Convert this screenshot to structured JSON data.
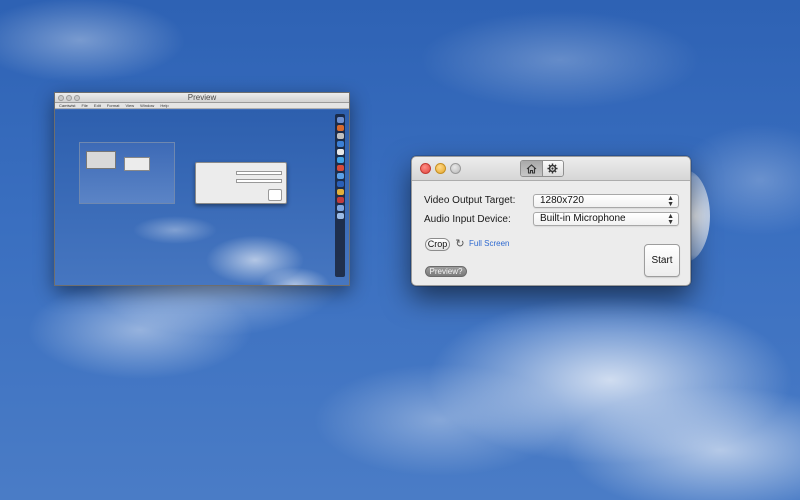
{
  "preview_window": {
    "title": "Preview",
    "menubar": [
      "Camtwist",
      "File",
      "Edit",
      "Format",
      "View",
      "Window",
      "Help"
    ]
  },
  "app_window": {
    "toolbar": {
      "home_icon": "house-icon",
      "settings_icon": "gear-icon"
    },
    "video_output": {
      "label": "Video Output Target:",
      "value": "1280x720"
    },
    "audio_input": {
      "label": "Audio Input Device:",
      "value": "Built-in Microphone"
    },
    "crop_label": "Crop",
    "full_screen_label": "Full Screen",
    "preview_label": "Preview?",
    "start_label": "Start"
  },
  "colors": {
    "sky": "#3a6fc0",
    "link": "#2f6ad0",
    "close": "#e0443e",
    "minimize": "#e5a72a"
  }
}
